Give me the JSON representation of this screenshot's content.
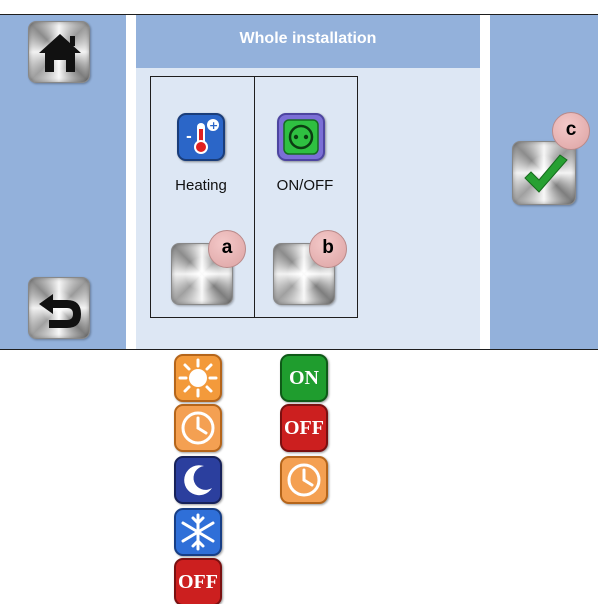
{
  "header": {
    "title": "Whole installation"
  },
  "columns": [
    {
      "label": "Heating",
      "badge": "a"
    },
    {
      "label": "ON/OFF",
      "badge": "b"
    }
  ],
  "confirm": {
    "badge": "c"
  },
  "legend": {
    "column_a": [
      {
        "icon": "sun-icon",
        "color": "#f39a3b"
      },
      {
        "icon": "clock-icon",
        "color": "#f4a052"
      },
      {
        "icon": "moon-icon",
        "color": "#2b3f9e"
      },
      {
        "icon": "snowflake-icon",
        "color": "#2f6fd8"
      },
      {
        "icon": "off-icon",
        "text": "OFF",
        "color": "#cc1f1f"
      }
    ],
    "column_b": [
      {
        "icon": "on-icon",
        "text": "ON",
        "color": "#1f9d2e"
      },
      {
        "icon": "off-icon",
        "text": "OFF",
        "color": "#cc1f1f"
      },
      {
        "icon": "clock-icon",
        "color": "#f4a052"
      }
    ]
  },
  "colors": {
    "sidebar": "#93b1db",
    "content": "#dde7f4",
    "badge": "#f0c2c2",
    "check": "#27a032"
  }
}
